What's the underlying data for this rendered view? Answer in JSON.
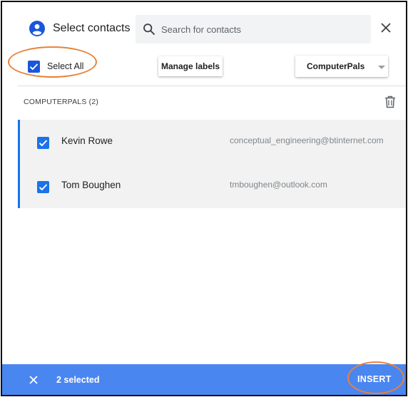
{
  "header": {
    "title": "Select contacts",
    "search": {
      "placeholder": "Search for contacts",
      "value": ""
    }
  },
  "toolbar": {
    "select_all_label": "Select All",
    "select_all_checked": true,
    "manage_labels_label": "Manage labels",
    "label_select": {
      "selected": "ComputerPals"
    }
  },
  "group": {
    "name": "COMPUTERPALS (2)"
  },
  "contacts": [
    {
      "name": "Kevin Rowe",
      "email": "conceptual_engineering@btinternet.com",
      "checked": true
    },
    {
      "name": "Tom Boughen",
      "email": "tmboughen@outlook.com",
      "checked": true
    }
  ],
  "footer": {
    "selected_count": "2 selected",
    "insert_label": "INSERT"
  },
  "colors": {
    "accent": "#1a73e8",
    "footer_bg": "#4a86f0",
    "highlight_ring": "#e8823a"
  },
  "icons": {
    "header": "account-circle-icon",
    "search": "search-icon",
    "close": "close-icon",
    "delete": "trash-icon",
    "check": "check-icon"
  }
}
